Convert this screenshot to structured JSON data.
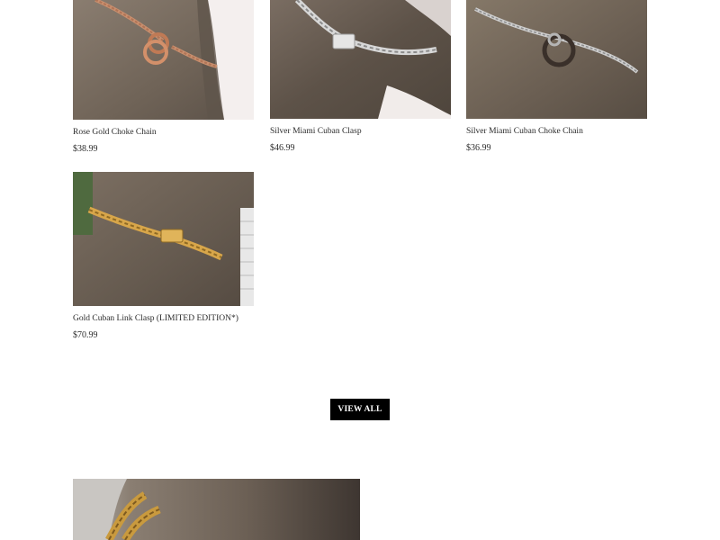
{
  "products": [
    {
      "title": "Rose Gold Choke Chain",
      "price": "$38.99",
      "image": "dog-neck-rose-gold-chain-photo"
    },
    {
      "title": "Silver Miami Cuban Clasp",
      "price": "$46.99",
      "image": "dog-neck-silver-cuban-clasp-photo"
    },
    {
      "title": "Silver Miami Cuban Choke Chain",
      "price": "$36.99",
      "image": "dog-neck-silver-choke-chain-photo"
    },
    {
      "title": "Gold Cuban Link Clasp (LIMITED EDITION*)",
      "price": "$70.99",
      "image": "dog-neck-gold-cuban-clasp-photo"
    }
  ],
  "view_all": {
    "label": "VIEW ALL"
  },
  "feature_image": "dog-neck-gold-chain-banner-photo",
  "colors": {
    "button_bg": "#000000",
    "button_text": "#ffffff",
    "text": "#2b2b2b",
    "page_bg": "#ffffff"
  }
}
